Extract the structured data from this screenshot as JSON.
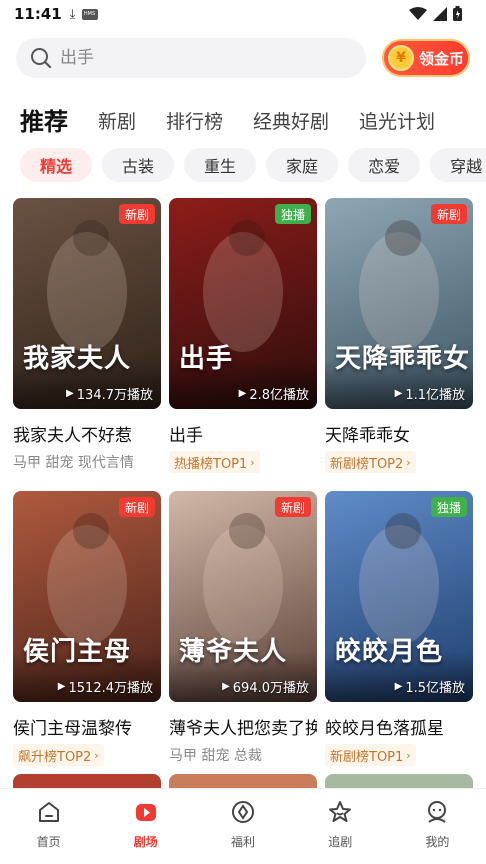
{
  "status_bar": {
    "time": "11:41",
    "hms_label": "HMS"
  },
  "search": {
    "placeholder": "出手",
    "coin_label": "领金币",
    "coin_symbol": "¥"
  },
  "tabs": [
    {
      "label": "推荐",
      "active": true
    },
    {
      "label": "新剧"
    },
    {
      "label": "排行榜"
    },
    {
      "label": "经典好剧"
    },
    {
      "label": "追光计划"
    }
  ],
  "chips": [
    {
      "label": "精选",
      "active": true
    },
    {
      "label": "古装"
    },
    {
      "label": "重生"
    },
    {
      "label": "家庭"
    },
    {
      "label": "恋爱"
    },
    {
      "label": "穿越"
    }
  ],
  "cards": [
    {
      "title": "我家夫人不好惹",
      "badge": "新剧",
      "badge_color": "red",
      "plays": "134.7万播放",
      "subtitle": "马甲 甜宠 现代言情",
      "art_title": "我家夫人",
      "colors": [
        "#6b5243",
        "#2e2118"
      ]
    },
    {
      "title": "出手",
      "badge": "独播",
      "badge_color": "green",
      "plays": "2.8亿播放",
      "rank": "热播榜TOP1",
      "art_title": "出手",
      "colors": [
        "#8e1d1a",
        "#2a0d0c"
      ]
    },
    {
      "title": "天降乖乖女",
      "badge": "新剧",
      "badge_color": "red",
      "plays": "1.1亿播放",
      "rank": "新剧榜TOP2",
      "art_title": "天降乖乖女",
      "colors": [
        "#8fa6b4",
        "#3d5564"
      ]
    },
    {
      "title": "侯门主母温黎传",
      "badge": "新剧",
      "badge_color": "red",
      "plays": "1512.4万播放",
      "rank": "飙升榜TOP2",
      "art_title": "侯门主母",
      "colors": [
        "#b05a3e",
        "#4b231a"
      ]
    },
    {
      "title": "薄爷夫人把您卖了换钱花",
      "badge": "新剧",
      "badge_color": "red",
      "plays": "694.0万播放",
      "subtitle": "马甲 甜宠 总裁",
      "art_title": "薄爷夫人",
      "colors": [
        "#d2b8a8",
        "#5a3f37"
      ]
    },
    {
      "title": "皎皎月色落孤星",
      "badge": "独播",
      "badge_color": "green",
      "plays": "1.5亿播放",
      "rank": "新剧榜TOP1",
      "art_title": "皎皎月色",
      "colors": [
        "#5f8cc9",
        "#1f3d6d"
      ]
    }
  ],
  "peek_colors": [
    "#b3402f",
    "#c97d5a",
    "#a7b9a0"
  ],
  "bottom_nav": [
    {
      "label": "首页",
      "icon": "home-icon"
    },
    {
      "label": "剧场",
      "icon": "theater-icon",
      "active": true
    },
    {
      "label": "福利",
      "icon": "gift-icon"
    },
    {
      "label": "追剧",
      "icon": "star-icon"
    },
    {
      "label": "我的",
      "icon": "profile-icon"
    }
  ],
  "accent_color": "#ef3b31"
}
